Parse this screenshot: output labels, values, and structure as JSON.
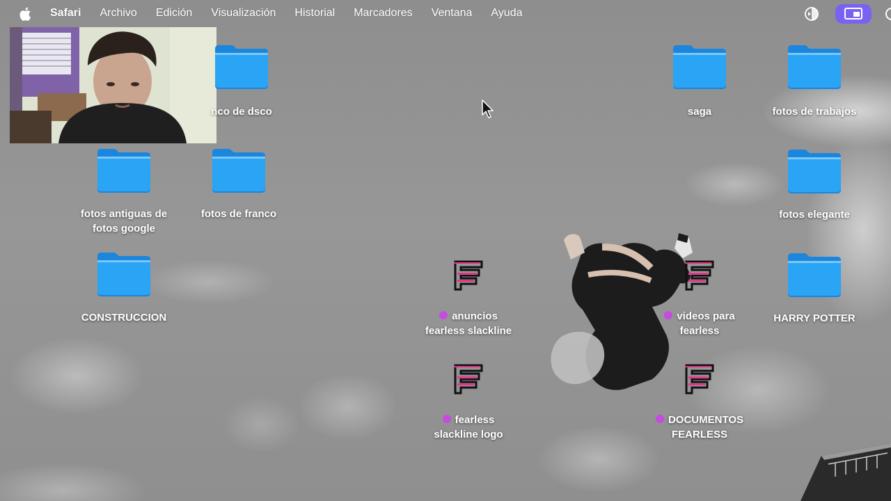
{
  "menubar": {
    "apple_icon": "apple-logo-icon",
    "app_name": "Safari",
    "items": [
      "Archivo",
      "Edición",
      "Visualización",
      "Historial",
      "Marcadores",
      "Ventana",
      "Ayuda"
    ],
    "status_icons": [
      "display-sync-icon",
      "screen-sharing-icon"
    ],
    "accent": "#7b61f2"
  },
  "webcam": {
    "description_icon": "webcam-overlay"
  },
  "desktop": {
    "folders": [
      {
        "label": "banco de dsco",
        "visible_label": "nco de dsco"
      },
      {
        "label": "saga"
      },
      {
        "label": "fotos de trabajos"
      },
      {
        "label_line1": "fotos antiguas de",
        "label_line2": "fotos google"
      },
      {
        "label": "fotos de franco"
      },
      {
        "label": "fotos elegante"
      },
      {
        "label": "CONSTRUCCION"
      },
      {
        "label": "HARRY POTTER"
      }
    ],
    "fearless_items": [
      {
        "line1": "anuncios",
        "line2": "fearless slackline",
        "tag_color": "#c64be0"
      },
      {
        "line1": "videos para",
        "line2": "fearless",
        "tag_color": "#c64be0"
      },
      {
        "line1": "fearless",
        "line2": "slackline logo",
        "tag_color": "#c64be0"
      },
      {
        "line1": "DOCUMENTOS",
        "line2": "FEARLESS",
        "tag_color": "#c64be0"
      }
    ],
    "folder_color": "#1e9bf0"
  }
}
